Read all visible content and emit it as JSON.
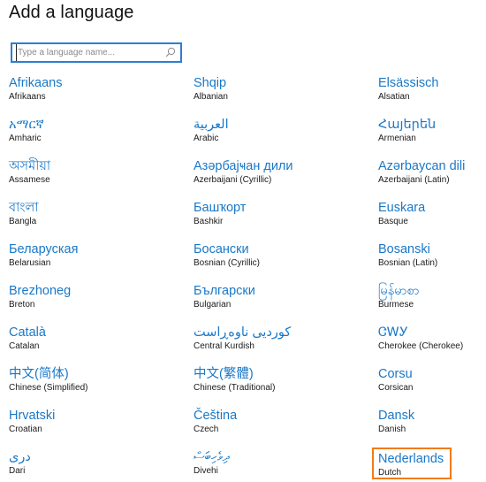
{
  "header": {
    "title": "Add a language"
  },
  "search": {
    "placeholder": "Type a language name...",
    "value": "",
    "icon": "search-icon"
  },
  "accent_color": "#1a78c8",
  "selection_color": "#f27b1a",
  "languages": [
    {
      "native": "Afrikaans",
      "english": "Afrikaans",
      "selected": false
    },
    {
      "native": "Shqip",
      "english": "Albanian",
      "selected": false
    },
    {
      "native": "Elsässisch",
      "english": "Alsatian",
      "selected": false
    },
    {
      "native": "አማርኛ",
      "english": "Amharic",
      "selected": false
    },
    {
      "native": "العربية",
      "english": "Arabic",
      "selected": false
    },
    {
      "native": "Հայերեն",
      "english": "Armenian",
      "selected": false
    },
    {
      "native": "অসমীয়া",
      "english": "Assamese",
      "selected": false
    },
    {
      "native": "Азәрбајҹан дили",
      "english": "Azerbaijani (Cyrillic)",
      "selected": false
    },
    {
      "native": "Azərbaycan dili",
      "english": "Azerbaijani (Latin)",
      "selected": false
    },
    {
      "native": "বাংলা",
      "english": "Bangla",
      "selected": false
    },
    {
      "native": "Башҡорт",
      "english": "Bashkir",
      "selected": false
    },
    {
      "native": "Euskara",
      "english": "Basque",
      "selected": false
    },
    {
      "native": "Беларуская",
      "english": "Belarusian",
      "selected": false
    },
    {
      "native": "Босански",
      "english": "Bosnian (Cyrillic)",
      "selected": false
    },
    {
      "native": "Bosanski",
      "english": "Bosnian (Latin)",
      "selected": false
    },
    {
      "native": "Brezhoneg",
      "english": "Breton",
      "selected": false
    },
    {
      "native": "Български",
      "english": "Bulgarian",
      "selected": false
    },
    {
      "native": "မြန်မာစာ",
      "english": "Burmese",
      "selected": false
    },
    {
      "native": "Català",
      "english": "Catalan",
      "selected": false
    },
    {
      "native": "کوردیی ناوەڕاست",
      "english": "Central Kurdish",
      "selected": false
    },
    {
      "native": "ᏣᎳᎩ",
      "english": "Cherokee (Cherokee)",
      "selected": false
    },
    {
      "native": "中文(简体)",
      "english": "Chinese (Simplified)",
      "selected": false
    },
    {
      "native": "中文(繁體)",
      "english": "Chinese (Traditional)",
      "selected": false
    },
    {
      "native": "Corsu",
      "english": "Corsican",
      "selected": false
    },
    {
      "native": "Hrvatski",
      "english": "Croatian",
      "selected": false
    },
    {
      "native": "Čeština",
      "english": "Czech",
      "selected": false
    },
    {
      "native": "Dansk",
      "english": "Danish",
      "selected": false
    },
    {
      "native": "درى",
      "english": "Dari",
      "selected": false
    },
    {
      "native": "ދިވެހިބަސް",
      "english": "Divehi",
      "selected": false
    },
    {
      "native": "Nederlands",
      "english": "Dutch",
      "selected": true
    }
  ]
}
